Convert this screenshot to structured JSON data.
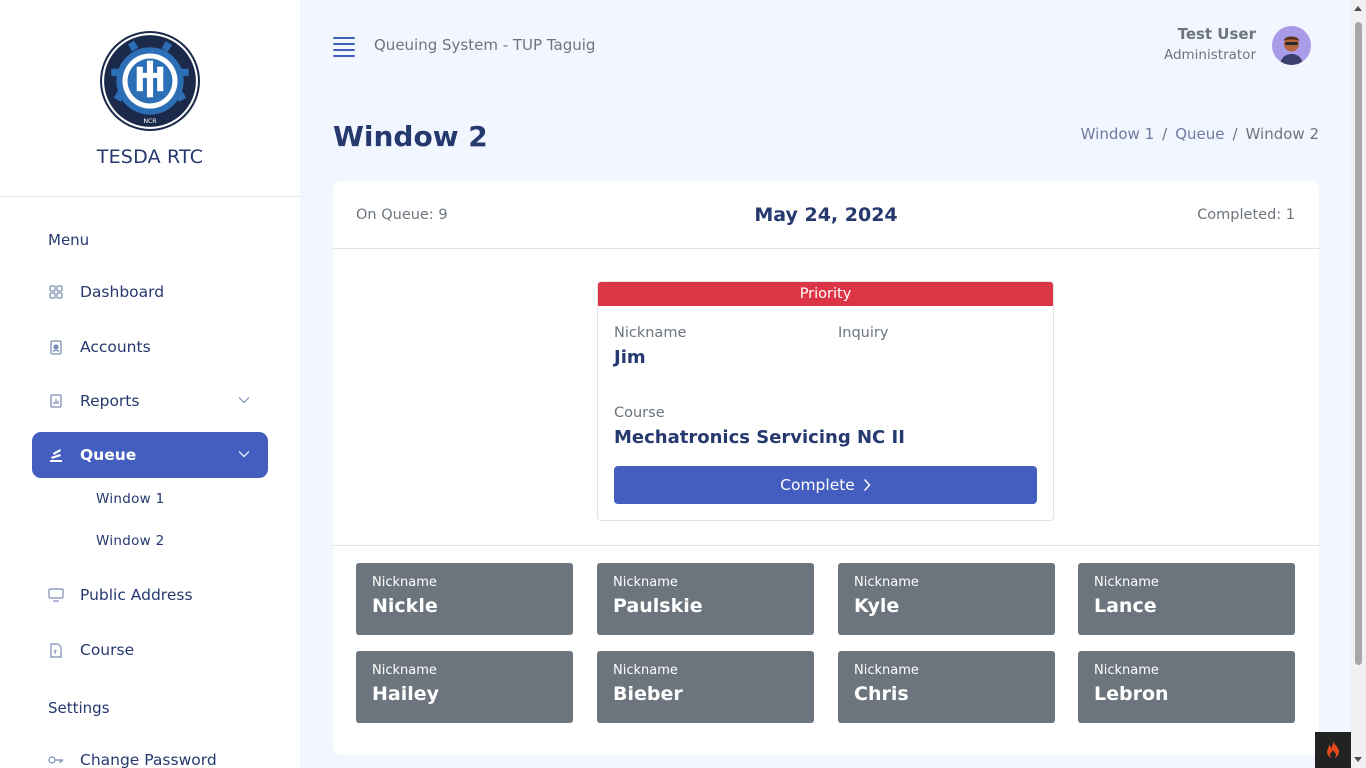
{
  "brand": {
    "name": "TESDA RTC",
    "logo_text_top": "REGIONAL TRAINING CENTER",
    "logo_text_bottom": "NCR"
  },
  "sidebar": {
    "menu_title": "Menu",
    "items": [
      {
        "label": "Dashboard",
        "icon": "grid-icon"
      },
      {
        "label": "Accounts",
        "icon": "person-badge-icon"
      },
      {
        "label": "Reports",
        "icon": "bar-chart-icon"
      },
      {
        "label": "Queue",
        "icon": "stack-icon"
      },
      {
        "label": "Public Address",
        "icon": "display-icon"
      },
      {
        "label": "Course",
        "icon": "file-icon"
      }
    ],
    "queue_sub": [
      "Window 1",
      "Window 2"
    ],
    "settings_title": "Settings",
    "settings_items": [
      {
        "label": "Change Password",
        "icon": "key-icon"
      }
    ]
  },
  "header": {
    "app_title": "Queuing System - TUP Taguig",
    "user_name": "Test User",
    "user_role": "Administrator"
  },
  "page": {
    "title": "Window 2",
    "breadcrumb": [
      "Window 1",
      "Queue",
      "Window 2"
    ]
  },
  "card": {
    "on_queue": "On Queue: 9",
    "date": "May 24, 2024",
    "completed": "Completed: 1",
    "current": {
      "band": "Priority",
      "nickname_label": "Nickname",
      "nickname": "Jim",
      "inquiry_label": "Inquiry",
      "inquiry": "",
      "course_label": "Course",
      "course": "Mechatronics Servicing NC II",
      "button": "Complete"
    },
    "queue": [
      {
        "label": "Nickname",
        "name": "Nickle"
      },
      {
        "label": "Nickname",
        "name": "Paulskie"
      },
      {
        "label": "Nickname",
        "name": "Kyle"
      },
      {
        "label": "Nickname",
        "name": "Lance"
      },
      {
        "label": "Nickname",
        "name": "Hailey"
      },
      {
        "label": "Nickname",
        "name": "Bieber"
      },
      {
        "label": "Nickname",
        "name": "Chris"
      },
      {
        "label": "Nickname",
        "name": "Lebron"
      }
    ]
  },
  "colors": {
    "primary": "#435ebe",
    "danger": "#dc3545",
    "secondary": "#6c757d",
    "text": "#25396f",
    "bg": "#f2f7ff"
  }
}
